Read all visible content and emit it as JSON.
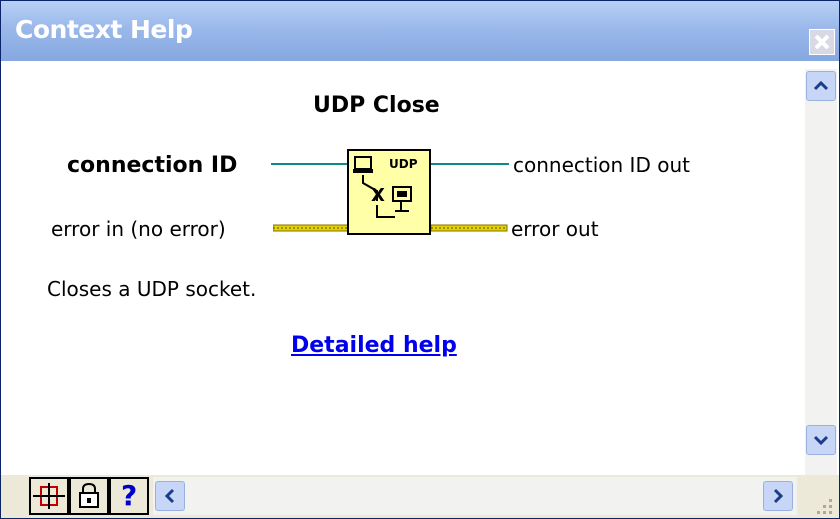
{
  "window": {
    "title": "Context Help",
    "close_label": "Close"
  },
  "vi": {
    "name": "UDP Close",
    "icon_text": "UDP",
    "inputs": {
      "connection_id": "connection ID",
      "error_in": "error in (no error)"
    },
    "outputs": {
      "connection_id_out": "connection ID out",
      "error_out": "error out"
    },
    "description": "Closes a UDP socket.",
    "detailed_help_link": "Detailed help"
  },
  "toolbar": {
    "buttons": [
      {
        "icon": "show-optional-terminals-icon"
      },
      {
        "icon": "lock-icon"
      },
      {
        "icon": "help-icon",
        "glyph": "?"
      }
    ]
  },
  "colors": {
    "titlebar": "#9ab8ea",
    "link": "#0000ee",
    "vi_icon_bg": "#ffffa8",
    "reference_wire": "#0f8a8a",
    "error_wire": "#c8b400"
  }
}
